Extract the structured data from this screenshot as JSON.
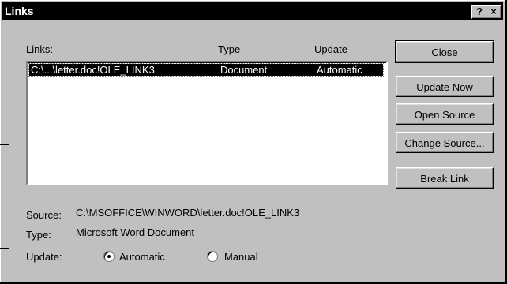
{
  "window": {
    "title": "Links",
    "help_label": "?",
    "close_label": "×"
  },
  "list": {
    "header_links": "Links:",
    "header_type": "Type",
    "header_update": "Update",
    "rows": [
      {
        "link": "C:\\...\\letter.doc!OLE_LINK3",
        "type": "Document",
        "update": "Automatic"
      }
    ]
  },
  "buttons": {
    "close": "Close",
    "update_now": "Update Now",
    "open_source": "Open Source",
    "change_source": "Change Source...",
    "break_link": "Break Link"
  },
  "details": {
    "source_label": "Source:",
    "source_value": "C:\\MSOFFICE\\WINWORD\\letter.doc!OLE_LINK3",
    "type_label": "Type:",
    "type_value": "Microsoft Word Document",
    "update_label": "Update:",
    "automatic_label": "Automatic",
    "manual_label": "Manual",
    "selected_update": "Automatic"
  }
}
